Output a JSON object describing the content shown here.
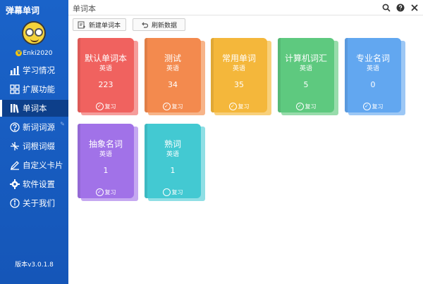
{
  "app": {
    "title": "弹幕单词",
    "user": "Enki2020",
    "version": "版本v3.0.1.8"
  },
  "sidebar": {
    "items": [
      {
        "label": "学习情况",
        "icon": "bar-chart-icon"
      },
      {
        "label": "扩展功能",
        "icon": "grid-icon"
      },
      {
        "label": "单词本",
        "icon": "books-icon",
        "active": true
      },
      {
        "label": "新词词源",
        "icon": "question-icon"
      },
      {
        "label": "词根词缀",
        "icon": "split-icon"
      },
      {
        "label": "自定义卡片",
        "icon": "edit-icon"
      },
      {
        "label": "软件设置",
        "icon": "gear-icon"
      },
      {
        "label": "关于我们",
        "icon": "info-icon"
      }
    ]
  },
  "main": {
    "title": "单词本",
    "buttons": {
      "new": "新建单词本",
      "refresh": "刷新数据"
    }
  },
  "cards": [
    {
      "name": "默认单词本",
      "lang": "英语",
      "count": "223",
      "review": "复习",
      "checked": true,
      "color": "#f0625f",
      "back": "#f59d9b"
    },
    {
      "name": "测试",
      "lang": "英语",
      "count": "34",
      "review": "复习",
      "checked": true,
      "color": "#f38a4e",
      "back": "#f7b489"
    },
    {
      "name": "常用单词",
      "lang": "英语",
      "count": "35",
      "review": "复习",
      "checked": true,
      "color": "#f4b73b",
      "back": "#f8d07b"
    },
    {
      "name": "计算机词汇",
      "lang": "英语",
      "count": "5",
      "review": "复习",
      "checked": true,
      "color": "#5ec97f",
      "back": "#98dcab"
    },
    {
      "name": "专业名词",
      "lang": "英语",
      "count": "0",
      "review": "复习",
      "checked": true,
      "color": "#62a7f0",
      "back": "#9cc7f5"
    },
    {
      "name": "抽象名词",
      "lang": "英语",
      "count": "1",
      "review": "复习",
      "checked": true,
      "color": "#a172e8",
      "back": "#c5a8f1"
    },
    {
      "name": "熟词",
      "lang": "英语",
      "count": "1",
      "review": "复习",
      "checked": false,
      "color": "#43c9d2",
      "back": "#8fdfe5"
    }
  ]
}
